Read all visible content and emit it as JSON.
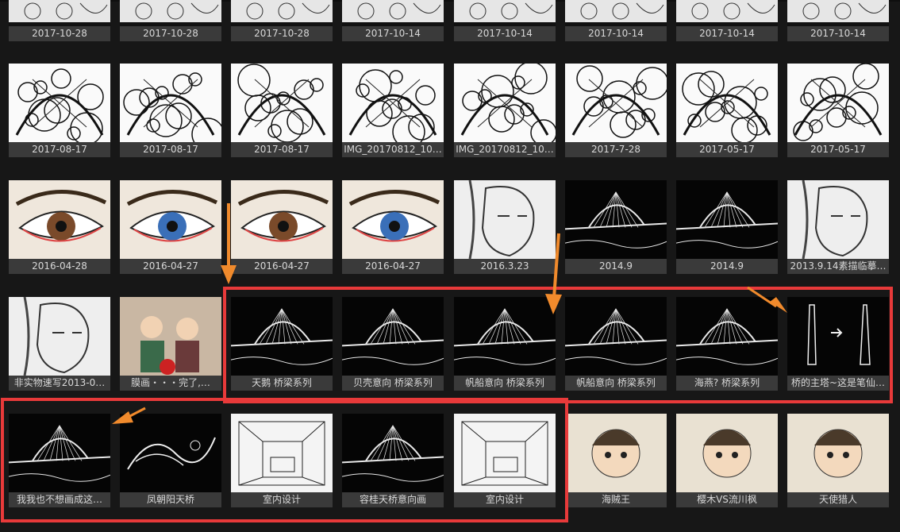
{
  "gallery": {
    "rows": [
      {
        "tiles": [
          {
            "caption": "2017-10-28",
            "icon": "sketch-thumbnail"
          },
          {
            "caption": "2017-10-28",
            "icon": "sketch-thumbnail"
          },
          {
            "caption": "2017-10-28",
            "icon": "sketch-thumbnail"
          },
          {
            "caption": "2017-10-14",
            "icon": "sketch-thumbnail"
          },
          {
            "caption": "2017-10-14",
            "icon": "sketch-thumbnail"
          },
          {
            "caption": "2017-10-14",
            "icon": "sketch-thumbnail"
          },
          {
            "caption": "2017-10-14",
            "icon": "sketch-thumbnail"
          },
          {
            "caption": "2017-10-14",
            "icon": "sketch-thumbnail"
          }
        ]
      },
      {
        "tiles": [
          {
            "caption": "2017-08-17",
            "icon": "elephant-sketch"
          },
          {
            "caption": "2017-08-17",
            "icon": "elephant-sketch"
          },
          {
            "caption": "2017-08-17",
            "icon": "elephant-sketch"
          },
          {
            "caption": "IMG_20170812_10…",
            "icon": "butterfly-sketch"
          },
          {
            "caption": "IMG_20170812_10…",
            "icon": "butterfly-sketch"
          },
          {
            "caption": "2017-7-28",
            "icon": "mandala-sketch"
          },
          {
            "caption": "2017-05-17",
            "icon": "parrot-sketch"
          },
          {
            "caption": "2017-05-17",
            "icon": "parrot-sketch"
          }
        ]
      },
      {
        "tiles": [
          {
            "caption": "2016-04-28",
            "icon": "eye-drawing"
          },
          {
            "caption": "2016-04-27",
            "icon": "eye-drawing"
          },
          {
            "caption": "2016-04-27",
            "icon": "eye-drawing"
          },
          {
            "caption": "2016-04-27",
            "icon": "eye-drawing"
          },
          {
            "caption": "2016.3.23",
            "icon": "face-sketch"
          },
          {
            "caption": "2014.9",
            "icon": "bridge-sketch"
          },
          {
            "caption": "2014.9",
            "icon": "bridge-sketch"
          },
          {
            "caption": "2013.9.14素描临摹…",
            "icon": "portrait-sketch"
          }
        ]
      },
      {
        "tiles": [
          {
            "caption": "非实物速写2013-0…",
            "icon": "portrait-sketch"
          },
          {
            "caption": "膜画・・・完了,…",
            "icon": "photo"
          },
          {
            "caption": "天鹅 桥梁系列",
            "icon": "bridge-sketch"
          },
          {
            "caption": "贝壳意向 桥梁系列",
            "icon": "bridge-sketch"
          },
          {
            "caption": "帆船意向 桥梁系列",
            "icon": "bridge-sketch"
          },
          {
            "caption": "帆船意向 桥梁系列",
            "icon": "bridge-sketch"
          },
          {
            "caption": "海燕? 桥梁系列",
            "icon": "bridge-sketch"
          },
          {
            "caption": "桥的主塔~这是笔仙…",
            "icon": "brush-sketch"
          }
        ]
      },
      {
        "tiles": [
          {
            "caption": "我我也不想画成这…",
            "icon": "bridge-sketch"
          },
          {
            "caption": "凤朝阳天桥",
            "icon": "phoenix-sketch"
          },
          {
            "caption": "室内设计",
            "icon": "interior-sketch"
          },
          {
            "caption": "容桂天桥意向画",
            "icon": "bridge-sketch"
          },
          {
            "caption": "室内设计",
            "icon": "interior-sketch"
          },
          {
            "caption": "海贼王",
            "icon": "anime-drawing"
          },
          {
            "caption": "樱木VS流川枫",
            "icon": "anime-drawing"
          },
          {
            "caption": "天使猎人",
            "icon": "anime-drawing"
          }
        ]
      }
    ]
  },
  "colors": {
    "highlight": "#e83a3a",
    "arrow": "#f08a2c",
    "caption_bg": "#3a3a3a",
    "background": "#171717"
  }
}
